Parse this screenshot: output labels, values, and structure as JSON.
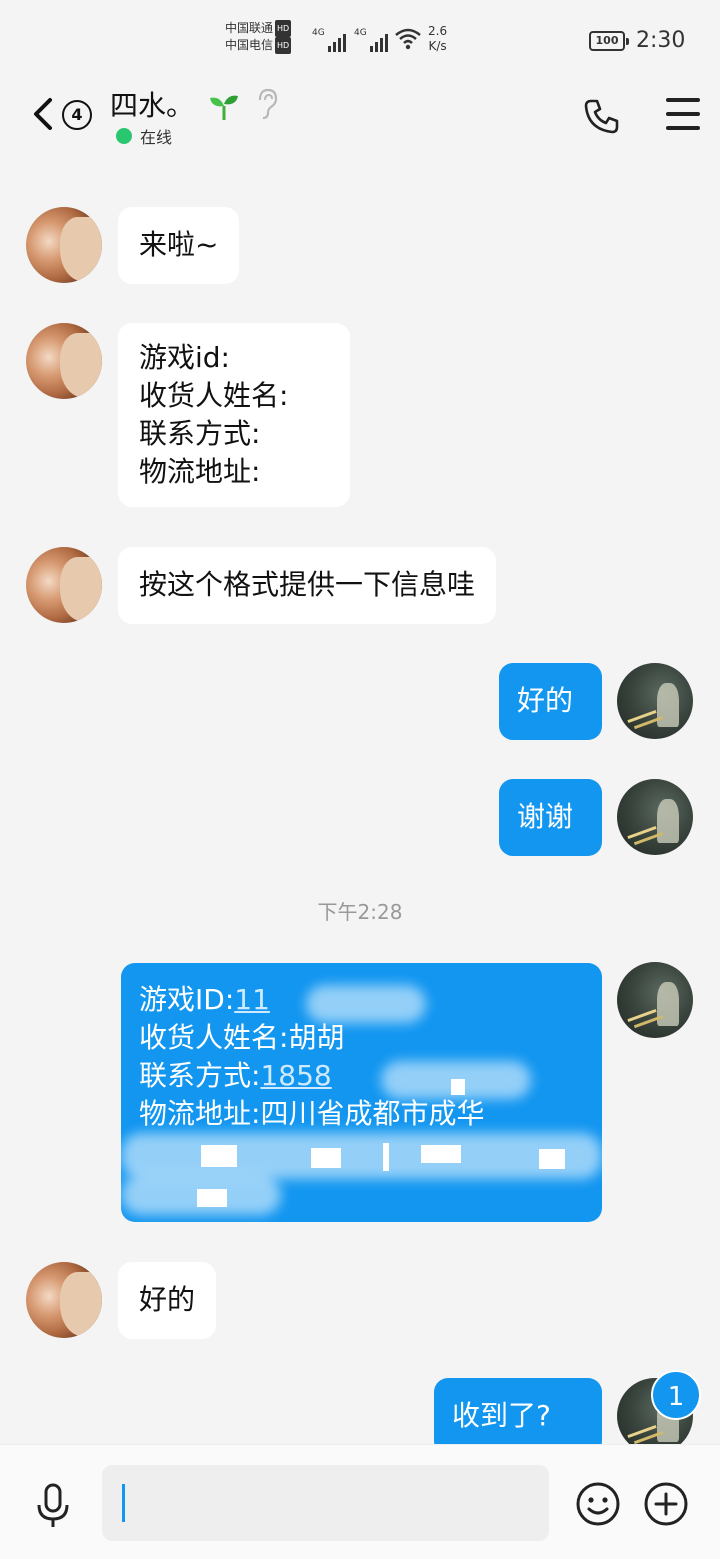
{
  "status_bar": {
    "carrier1": "中国联通",
    "carrier2": "中国电信",
    "hd": "HD",
    "net1": "4G",
    "net2": "4G",
    "speed_value": "2.6",
    "speed_unit": "K/s",
    "battery": "100",
    "time": "2:30"
  },
  "header": {
    "unread_count": "4",
    "contact_name": "四水。",
    "presence": "在线"
  },
  "messages": [
    {
      "side": "in",
      "text": "来啦~"
    },
    {
      "side": "in",
      "lines": [
        "游戏id:",
        "收货人姓名:",
        "联系方式:",
        "物流地址:"
      ]
    },
    {
      "side": "in",
      "text": "按这个格式提供一下信息哇"
    },
    {
      "side": "out",
      "text": "好的"
    },
    {
      "side": "out",
      "text": "谢谢"
    },
    {
      "side": "in",
      "text": "好的"
    },
    {
      "side": "out",
      "text": "收到了?"
    }
  ],
  "time_separator": "下午2:28",
  "info_card": {
    "game_id_label": "游戏ID:",
    "game_id_value": "11",
    "name_label": "收货人姓名:",
    "name_value": "胡胡",
    "contact_label": "联系方式:",
    "contact_value": "1858",
    "address_label": "物流地址:",
    "address_value": "四川省成都市成华"
  },
  "unread_badge": "1",
  "colors": {
    "accent": "#1296f0",
    "online": "#29c76f",
    "background": "#f4f4f4"
  },
  "icons": [
    "back-arrow-icon",
    "phone-icon",
    "menu-icon",
    "sprout-icon",
    "ear-icon",
    "microphone-icon",
    "emoji-icon",
    "plus-icon"
  ]
}
